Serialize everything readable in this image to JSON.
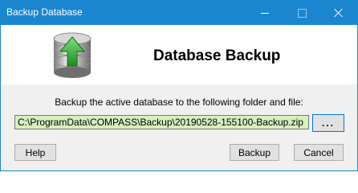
{
  "window": {
    "title": "Backup Database"
  },
  "header": {
    "heading": "Database Backup",
    "icon": "database-upload-icon"
  },
  "main": {
    "instruction": "Backup the active database to the following folder and file:",
    "path_value": "C:\\ProgramData\\COMPASS\\Backup\\20190528-155100-Backup.zip",
    "browse_label": "..."
  },
  "buttons": {
    "help": "Help",
    "backup": "Backup",
    "cancel": "Cancel"
  },
  "colors": {
    "titlebar": "#1a86d0",
    "path_field_bg": "#d6efbf",
    "arrow_green": "#2e9e2e"
  }
}
